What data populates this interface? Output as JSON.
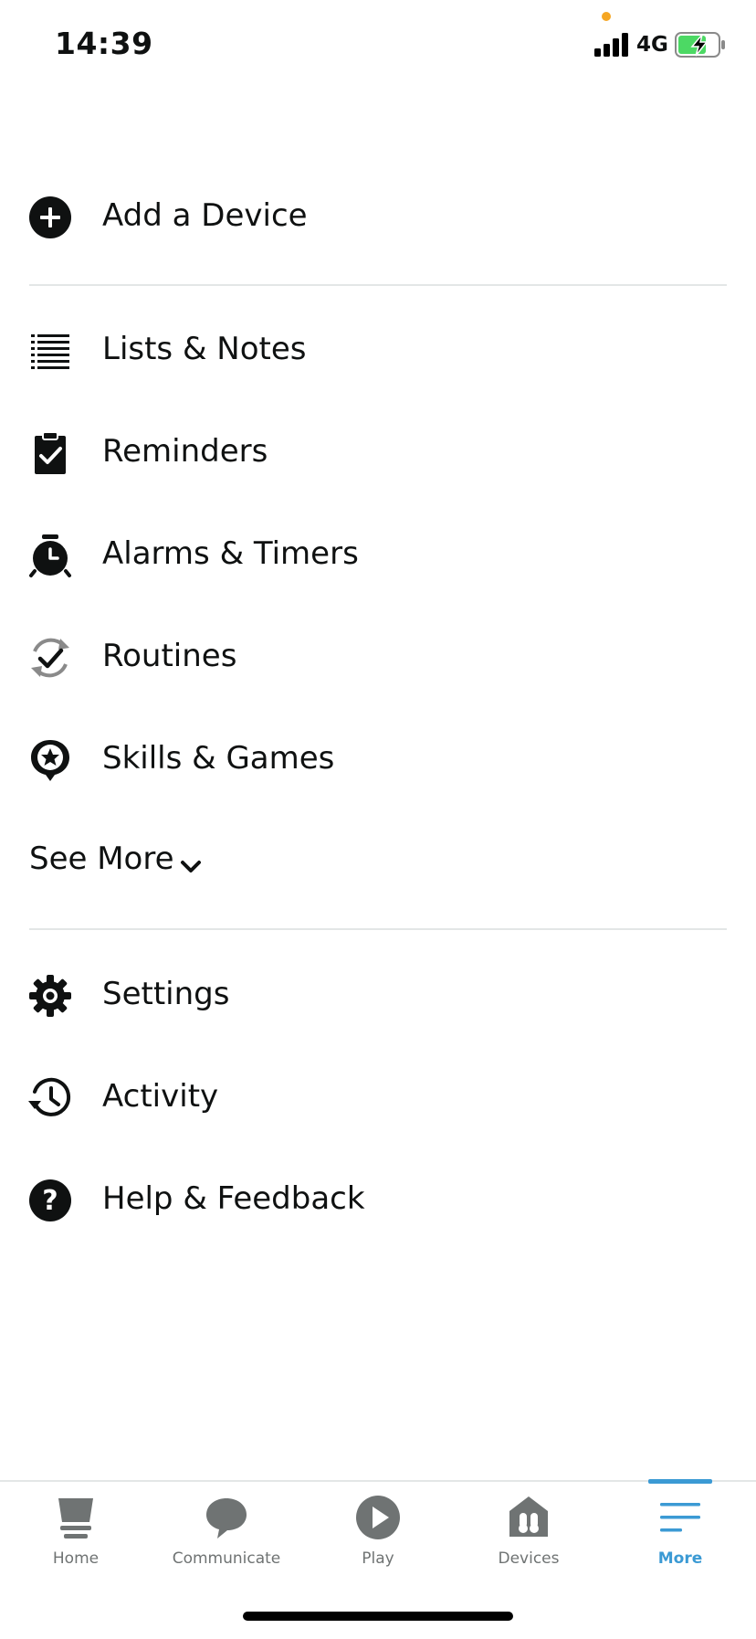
{
  "status_bar": {
    "time": "14:39",
    "network": "4G"
  },
  "menu": {
    "add_device": "Add a Device",
    "lists_notes": "Lists & Notes",
    "reminders": "Reminders",
    "alarms_timers": "Alarms & Timers",
    "routines": "Routines",
    "skills_games": "Skills & Games",
    "see_more": "See More",
    "settings": "Settings",
    "activity": "Activity",
    "help_feedback": "Help & Feedback"
  },
  "tabs": [
    {
      "label": "Home",
      "icon": "home-icon",
      "active": false
    },
    {
      "label": "Communicate",
      "icon": "chat-bubble-icon",
      "active": false
    },
    {
      "label": "Play",
      "icon": "play-icon",
      "active": false
    },
    {
      "label": "Devices",
      "icon": "devices-icon",
      "active": false
    },
    {
      "label": "More",
      "icon": "menu-icon",
      "active": true
    }
  ],
  "colors": {
    "accent": "#3b9ad4",
    "text": "#0f1111",
    "inactive": "#6f7373",
    "divider": "#e3e6e6",
    "battery_fill": "#4cd964",
    "status_dot": "#f5a623"
  }
}
